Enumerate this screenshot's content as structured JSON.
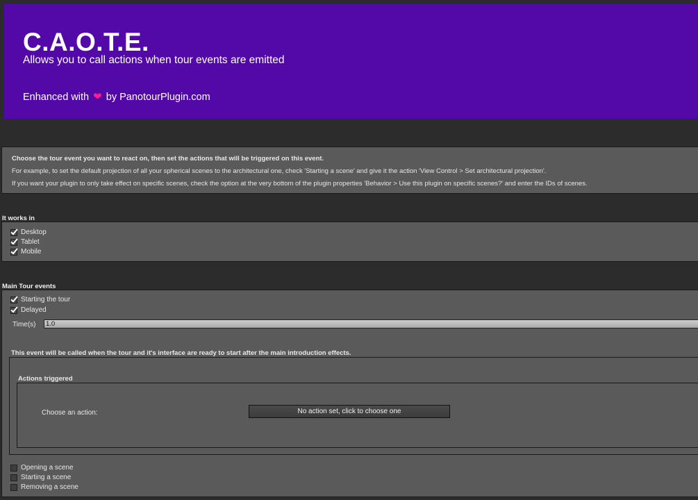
{
  "header": {
    "title": "C.A.O.T.E.",
    "subtitle": "Allows you to call actions when tour events are emitted",
    "credit_prefix": "Enhanced with",
    "credit_suffix": "by PanotourPlugin.com",
    "background_color": "#5309a7",
    "heart_color": "#ff1c8d",
    "heart_icon": "heart-icon"
  },
  "info": {
    "line1": "Choose the tour event you want to react on, then set the actions that will be triggered on this event.",
    "line2": "For example, to set the default projection of all your spherical scenes to the architectural one, check 'Starting a scene' and give it the action 'View Control > Set architectural projection'.",
    "line3": "If you want your plugin to only take effect on specific scenes, check the option at the very bottom of the plugin properties 'Behavior > Use this plugin on specific scenes?' and enter the IDs of scenes."
  },
  "works_in": {
    "title": "It works in",
    "items": [
      {
        "label": "Desktop",
        "checked": true
      },
      {
        "label": "Tablet",
        "checked": true
      },
      {
        "label": "Mobile",
        "checked": true
      }
    ]
  },
  "main_events": {
    "title": "Main Tour events",
    "starting_tour": {
      "label": "Starting the tour",
      "checked": true
    },
    "delayed": {
      "label": "Delayed",
      "checked": true
    },
    "time_label": "Time(s)",
    "time_value": "1.0",
    "event_description": "This event will be called when the tour and it's interface are ready to start after the main introduction effects.",
    "actions": {
      "title": "Actions triggered",
      "choose_label": "Choose an action:",
      "button_label": "No action set, click to choose one"
    },
    "other_events": [
      {
        "label": "Opening a scene",
        "checked": false
      },
      {
        "label": "Starting a scene",
        "checked": false
      },
      {
        "label": "Removing a scene",
        "checked": false
      }
    ]
  }
}
